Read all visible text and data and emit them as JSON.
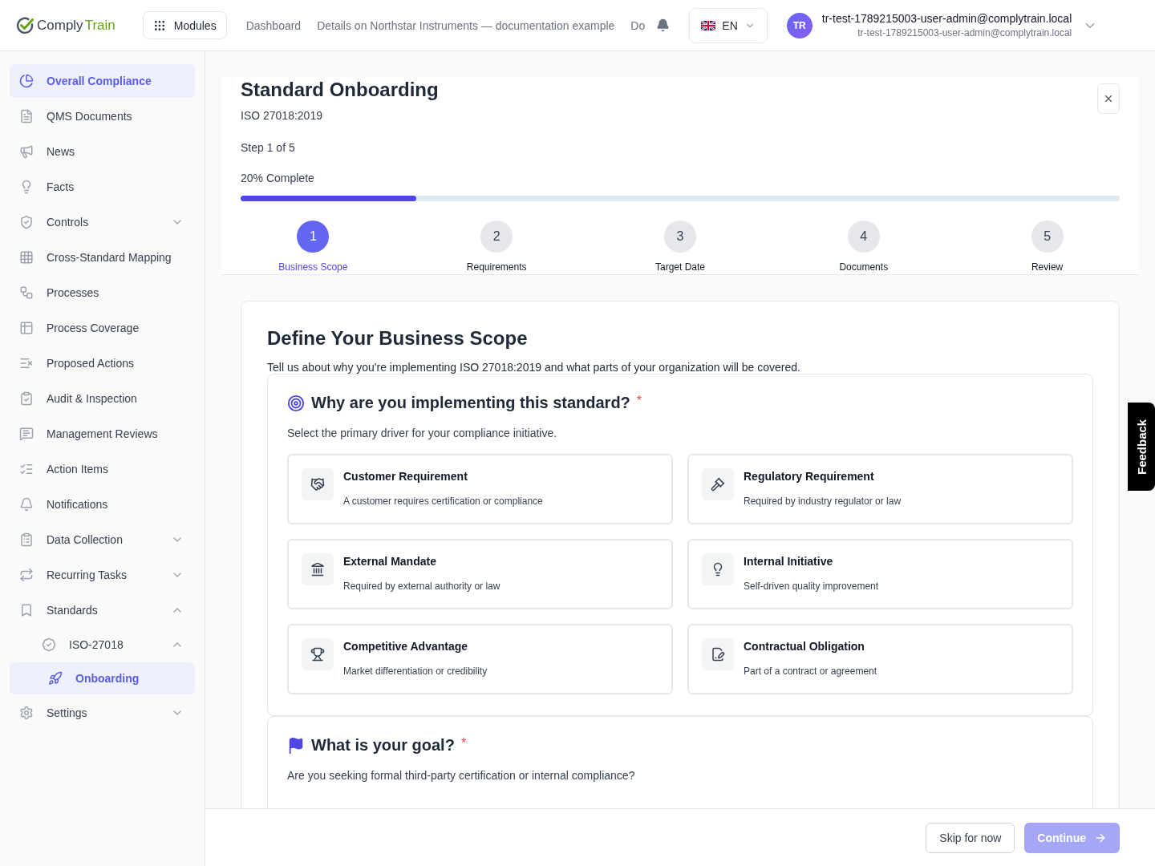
{
  "topbar": {
    "logo": {
      "part_1": "Comply",
      "part_2": "Train"
    },
    "modules_button": "Modules",
    "nav_links": [
      "Dashboard",
      "Details on Northstar Instruments — documentation example",
      "Do"
    ],
    "language": "EN",
    "user": {
      "avatar": "TR",
      "name": "tr-test-1789215003-user-admin@complytrain.local",
      "email": "tr-test-1789215003-user-admin@complytrain.local"
    }
  },
  "sidebar": {
    "items": [
      {
        "label": "Overall Compliance",
        "selected": true
      },
      {
        "label": "QMS Documents",
        "selected": false
      },
      {
        "label": "News",
        "selected": false
      },
      {
        "label": "Facts",
        "selected": false
      },
      {
        "label": "Controls",
        "selected": false,
        "expanded": false
      },
      {
        "label": "Cross-Standard Mapping",
        "selected": false
      },
      {
        "label": "Processes",
        "selected": false
      },
      {
        "label": "Process Coverage",
        "selected": false
      },
      {
        "label": "Proposed Actions",
        "selected": false
      },
      {
        "label": "Audit & Inspection",
        "selected": false
      },
      {
        "label": "Management Reviews",
        "selected": false
      },
      {
        "label": "Action Items",
        "selected": false
      },
      {
        "label": "Notifications",
        "selected": false
      },
      {
        "label": "Data Collection",
        "selected": false,
        "expanded": false
      },
      {
        "label": "Recurring Tasks",
        "selected": false,
        "expanded": false
      },
      {
        "label": "Standards",
        "selected": false,
        "expanded": true,
        "children": [
          {
            "label": "ISO-27018",
            "selected": false,
            "expanded": true,
            "children": [
              {
                "label": "Onboarding",
                "selected": true
              }
            ]
          }
        ]
      },
      {
        "label": "Settings",
        "selected": false,
        "expanded": false
      }
    ]
  },
  "wizard": {
    "title": "Standard Onboarding",
    "subtitle": "ISO 27018:2019",
    "step_text": "Step 1 of 5",
    "percent_text": "20% Complete",
    "progress": {
      "level": 0.2
    },
    "steps": [
      {
        "number": "1",
        "label": "Business Scope",
        "selected": true
      },
      {
        "number": "2",
        "label": "Requirements",
        "selected": false
      },
      {
        "number": "3",
        "label": "Target Date",
        "selected": false
      },
      {
        "number": "4",
        "label": "Documents",
        "selected": false
      },
      {
        "number": "5",
        "label": "Review",
        "selected": false
      }
    ]
  },
  "content": {
    "title": "Define Your Business Scope",
    "description": "Tell us about why you're implementing ISO 27018:2019 and what parts of your organization will be covered.",
    "sections": [
      {
        "title": "Why are you implementing this standard?",
        "required_mark": "*",
        "hint": "Select the primary driver for your compliance initiative.",
        "options": [
          {
            "title": "Customer Requirement",
            "description": "A customer requires certification or compliance",
            "selected": false
          },
          {
            "title": "Regulatory Requirement",
            "description": "Required by industry regulator or law",
            "selected": false
          },
          {
            "title": "External Mandate",
            "description": "Required by external authority or law",
            "selected": false
          },
          {
            "title": "Internal Initiative",
            "description": "Self-driven quality improvement",
            "selected": false
          },
          {
            "title": "Competitive Advantage",
            "description": "Market differentiation or credibility",
            "selected": false
          },
          {
            "title": "Contractual Obligation",
            "description": "Part of a contract or agreement",
            "selected": false
          }
        ]
      },
      {
        "title": "What is your goal?",
        "required_mark": "*",
        "hint": "Are you seeking formal third-party certification or internal compliance?"
      }
    ]
  },
  "footer": {
    "skip": "Skip for now",
    "continue": {
      "label": "Continue",
      "disabled": true
    }
  },
  "feedback_tab": "Feedback"
}
